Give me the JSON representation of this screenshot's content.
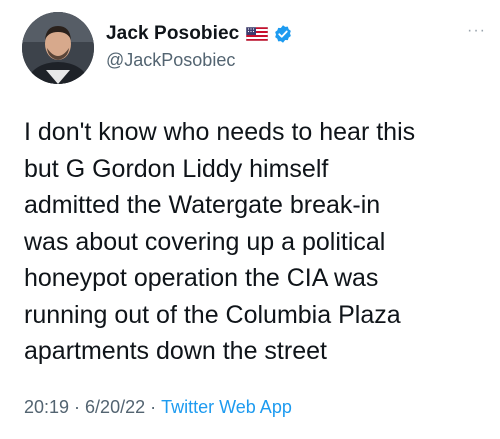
{
  "author": {
    "display_name": "Jack Posobiec",
    "handle": "@JackPosobiec",
    "verified": true,
    "flag_icon": "us-flag-icon"
  },
  "tweet": {
    "text": "I don't know who needs to hear this\nbut G Gordon Liddy himself\nadmitted the Watergate break-in\nwas about covering up a political\nhoneypot operation the CIA was\nrunning out of the Columbia Plaza\napartments down the street",
    "time": "20:19",
    "date": "6/20/22",
    "separator": "·",
    "source": "Twitter Web App"
  },
  "menu": {
    "more_label": "···"
  },
  "colors": {
    "text": "#0f1419",
    "secondary": "#536471",
    "link": "#1d9bf0",
    "verified": "#1d9bf0"
  }
}
